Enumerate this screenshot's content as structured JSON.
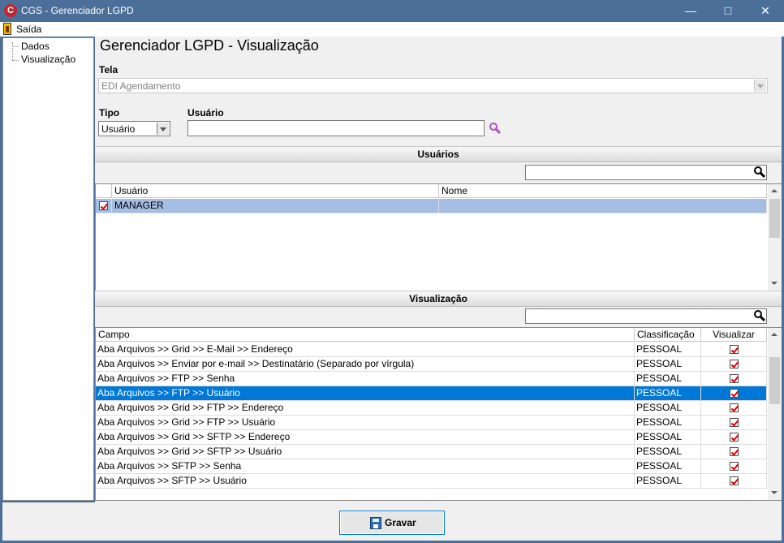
{
  "window": {
    "title": "CGS - Gerenciador LGPD",
    "app_icon_letter": "C",
    "controls": {
      "minimize": "—",
      "maximize": "□",
      "close": "✕"
    }
  },
  "menu": {
    "items": [
      {
        "label": "Saída",
        "icon": "exit-icon"
      }
    ]
  },
  "sidebar": {
    "items": [
      {
        "label": "Dados"
      },
      {
        "label": "Visualização"
      }
    ]
  },
  "page": {
    "title": "Gerenciador LGPD - Visualização"
  },
  "tela": {
    "label": "Tela",
    "value": "EDI Agendamento"
  },
  "tipo": {
    "label": "Tipo",
    "value": "Usuário"
  },
  "usuario": {
    "label": "Usuário",
    "value": "",
    "search_icon": "search-icon"
  },
  "usuarios_section": {
    "title": "Usuários",
    "search_value": "",
    "columns": [
      "Usuário",
      "Nome"
    ],
    "rows": [
      {
        "checked": true,
        "usuario": "MANAGER",
        "nome": ""
      }
    ]
  },
  "visualizacao_section": {
    "title": "Visualização",
    "search_value": "",
    "columns": [
      "Campo",
      "Classificação",
      "Visualizar"
    ],
    "rows": [
      {
        "campo": "Aba Arquivos  >> Grid >> E-Mail >> Endereço",
        "classificacao": "PESSOAL",
        "visualizar": true
      },
      {
        "campo": "Aba Arquivos >> Enviar por e-mail >> Destinatário (Separado por vírgula)",
        "classificacao": "PESSOAL",
        "visualizar": true
      },
      {
        "campo": "Aba Arquivos >> FTP >> Senha",
        "classificacao": "PESSOAL",
        "visualizar": true
      },
      {
        "campo": "Aba Arquivos >> FTP >> Usuário",
        "classificacao": "PESSOAL",
        "visualizar": true,
        "selected": true
      },
      {
        "campo": "Aba Arquivos >> Grid >> FTP >>  Endereço",
        "classificacao": "PESSOAL",
        "visualizar": true
      },
      {
        "campo": "Aba Arquivos >> Grid >> FTP >> Usuário",
        "classificacao": "PESSOAL",
        "visualizar": true
      },
      {
        "campo": "Aba Arquivos >> Grid >> SFTP >> Endereço",
        "classificacao": "PESSOAL",
        "visualizar": true
      },
      {
        "campo": "Aba Arquivos >> Grid >> SFTP >> Usuário",
        "classificacao": "PESSOAL",
        "visualizar": true
      },
      {
        "campo": "Aba Arquivos >> SFTP >> Senha",
        "classificacao": "PESSOAL",
        "visualizar": true
      },
      {
        "campo": "Aba Arquivos >> SFTP >> Usuário",
        "classificacao": "PESSOAL",
        "visualizar": true
      }
    ]
  },
  "footer": {
    "save_label": "Gravar",
    "save_icon": "save-disk-icon"
  },
  "colors": {
    "titlebar": "#4c6f9a",
    "selection": "#0078d7",
    "soft_selection": "#a4bde3",
    "check": "#d00000",
    "search_icon_accent": "#b14fc5"
  }
}
